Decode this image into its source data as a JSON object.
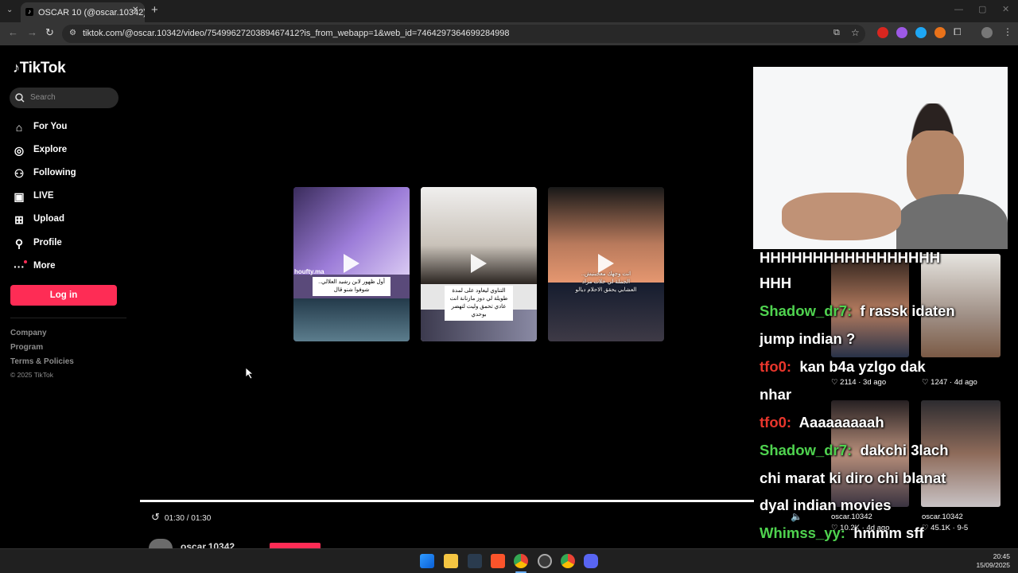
{
  "browser": {
    "tab_title": "OSCAR 10 (@oscar.10342)'s vi...",
    "url": "tiktok.com/@oscar.10342/video/7549962720389467412?is_from_webapp=1&web_id=7464297364699284998",
    "new_tab_glyph": "+",
    "close_glyph": "✕"
  },
  "tiktok": {
    "logo": "TikTok",
    "search_placeholder": "Search",
    "nav": [
      "For You",
      "Explore",
      "Following",
      "LIVE",
      "Upload",
      "Profile",
      "More"
    ],
    "login": "Log in",
    "footer": [
      "Company",
      "Program",
      "Terms & Policies",
      "© 2025 TikTok"
    ]
  },
  "videos": [
    {
      "caption": "أول ظهور لابن رشيد العلالي.. شوفوا شنو قال",
      "watermark": "houfty.ma"
    },
    {
      "caption": "التناوي ليعاود على لمدة طويلة لي دوز مازنانة انت عادي تحمق وليت لتهضر بوحدي",
      "watermark": ""
    },
    {
      "caption": "انت وجهك معجبنيش.. الجملة لي خلات مراد العشابي يحقق الاحلام ديالو",
      "watermark": ""
    }
  ],
  "player": {
    "time": "01:30 / 01:30",
    "progress": 1.0,
    "author_partial": "oscar.10342"
  },
  "chat": [
    {
      "user": "",
      "text": "HHHHHHHHHHHHHHHHH"
    },
    {
      "user": "",
      "text": "HHH"
    },
    {
      "user": "Shadow_dr7:",
      "text": "f rassk idaten",
      "color": "green"
    },
    {
      "user": "",
      "text": "jump indian ?"
    },
    {
      "user": "tfo0:",
      "text": "kan b4a yzlgo dak",
      "color": "red"
    },
    {
      "user": "",
      "text": "nhar"
    },
    {
      "user": "tfo0:",
      "text": "Aaaaaaaaah",
      "color": "red"
    },
    {
      "user": "Shadow_dr7:",
      "text": "dakchi 3lach",
      "color": "green"
    },
    {
      "user": "",
      "text": "chi marat ki diro chi blanat"
    },
    {
      "user": "",
      "text": "dyal indian movies"
    },
    {
      "user": "Whimss_yy:",
      "text": "hmmm sff",
      "color": "green"
    }
  ],
  "grid_meta": [
    {
      "likes": "2114",
      "age": "3d ago"
    },
    {
      "likes": "1247",
      "age": "4d ago"
    },
    {
      "author": "oscar.10342",
      "likes": "10.2K",
      "age": "4d ago"
    },
    {
      "author": "oscar.10342",
      "likes": "45.1K",
      "age": "9-5"
    }
  ],
  "taskbar": {
    "time": "20:45",
    "date": "15/09/2025"
  },
  "colors": {
    "accent": "#fe2c55",
    "chat_green": "#4fd34f",
    "chat_red": "#e8362c"
  }
}
